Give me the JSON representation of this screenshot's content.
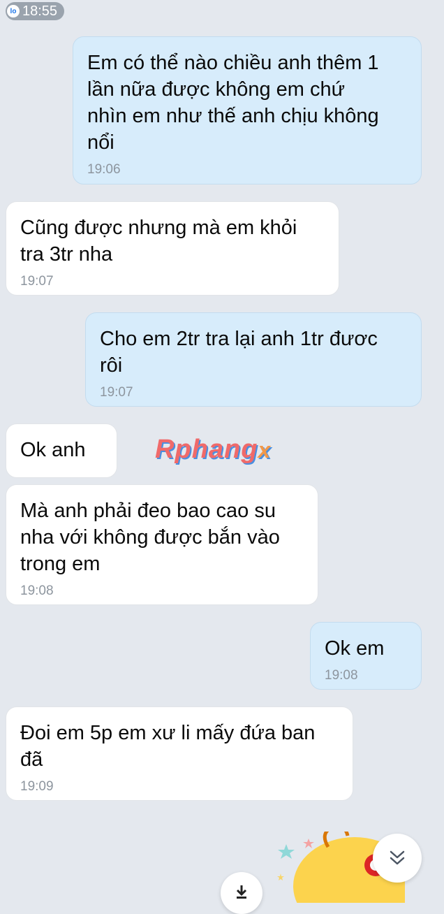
{
  "status_bar": {
    "time": "18:55",
    "app_icon_label": "lo"
  },
  "messages": [
    {
      "direction": "out",
      "text": "Em có thể nào chiều anh thêm 1\nlần nữa được không em chứ\nnhìn em như thế anh chịu không\nnổi",
      "time": "19:06"
    },
    {
      "direction": "in",
      "text": "Cũng được nhưng mà em khỏi\ntra 3tr nha",
      "time": "19:07"
    },
    {
      "direction": "out",
      "text": "Cho em 2tr tra lại anh 1tr đươc\nrôi",
      "time": "19:07"
    },
    {
      "direction": "in",
      "text": "Ok anh",
      "time": ""
    },
    {
      "direction": "in",
      "text": "Mà anh phải đeo bao cao su\nnha với không được bắn vào\ntrong em",
      "time": "19:08"
    },
    {
      "direction": "out",
      "text": "Ok em",
      "time": "19:08"
    },
    {
      "direction": "in",
      "text": "Đoi em 5p em xư li mấy đứa ban\nđã",
      "time": "19:09"
    }
  ],
  "watermark": {
    "main": "Rphang",
    "suffix": "x"
  },
  "icons": {
    "scroll_down": "chevron-double-down-icon",
    "download": "download-arrow-icon",
    "sticker": "cartoon-sticker"
  },
  "colors": {
    "background": "#e4e8ee",
    "outgoing_bubble": "#d7ecfb",
    "incoming_bubble": "#ffffff",
    "timestamp": "#8d959e"
  }
}
